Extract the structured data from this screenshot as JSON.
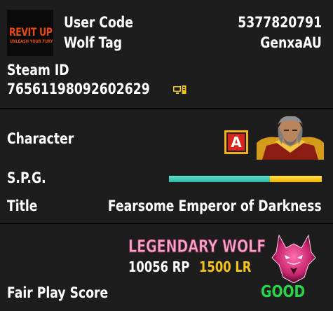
{
  "header": {
    "logo_text": "REVIT UP",
    "logo_tagline": "UNLEASH YOUR FURY",
    "user_code_label": "User Code",
    "user_code_value": "5377820791",
    "wolf_tag_label": "Wolf Tag",
    "wolf_tag_value": "GenxaAU",
    "steam_id_label": "Steam ID",
    "steam_id_value": "76561198092602629",
    "platform_icon": "pc-icon"
  },
  "character": {
    "label": "Character",
    "rank_badge": "A",
    "portrait_icon": "character-portrait-icon",
    "spg_label": "S.P.G.",
    "spg_level": 0.66,
    "title_label": "Title",
    "title_value": "Fearsome Emperor of Darkness"
  },
  "rank": {
    "name": "LEGENDARY WOLF",
    "rp": "10056 RP",
    "lr": "1500 LR",
    "emblem_icon": "wolf-emblem-icon",
    "fair_play_label": "Fair Play Score",
    "fair_play_value": "GOOD"
  },
  "colors": {
    "background": "#1d1d1d",
    "divider": "#070707",
    "spg_primary": "#3cc7b4",
    "spg_secondary": "#f5c000",
    "lr_color": "#f5c518",
    "fair_play_good": "#2ad44a",
    "legendary_pink": "#f3a7c9",
    "rank_badge_border": "#f0b21c",
    "rank_badge_fill": "#d9251b"
  }
}
